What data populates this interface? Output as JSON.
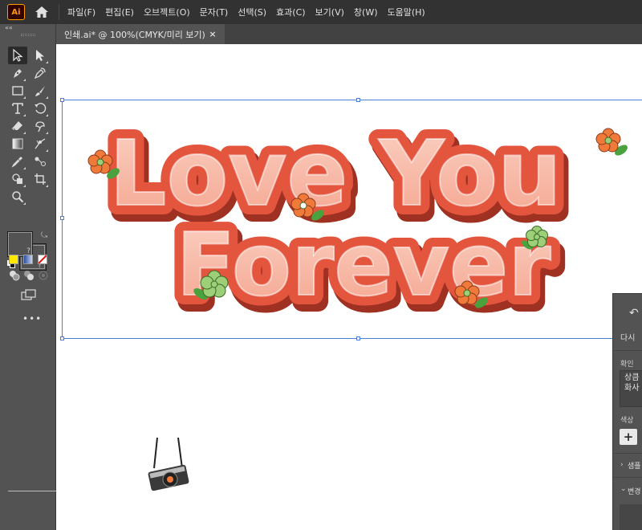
{
  "app": {
    "logo_text": "Ai",
    "accent": "#ff9a00"
  },
  "menu": {
    "items": [
      "파일(F)",
      "편집(E)",
      "오브젝트(O)",
      "문자(T)",
      "선택(S)",
      "효과(C)",
      "보기(V)",
      "창(W)",
      "도움말(H)"
    ]
  },
  "document_tab": {
    "title": "인쇄.ai* @ 100%(CMYK/미리 보기)",
    "close_label": "×"
  },
  "toolbar": {
    "collapse_label": "««",
    "tools": [
      "selection-tool",
      "direct-selection-tool",
      "pen-tool",
      "curvature-tool",
      "rectangle-tool",
      "paintbrush-tool",
      "type-tool",
      "rotate-tool",
      "eraser-tool",
      "warp-tool",
      "gradient-tool",
      "mesh-tool",
      "eyedropper-tool",
      "blend-tool",
      "shape-builder-tool",
      "artboard-tool",
      "zoom-tool"
    ],
    "fill_unknown": "?",
    "stroke_unknown": "?",
    "more_label": "•••",
    "swatches": {
      "color": "#ffe800",
      "gradient": "#3a5fb0",
      "none": "#ffffff"
    }
  },
  "artwork": {
    "line1": "Love You",
    "line2": "Forever",
    "fill_color": "#f7b5a2",
    "outline_color": "#e4553e",
    "shadow_color": "#b93b2b",
    "flower_orange": "#f07a3a",
    "flower_green": "#9ccf78",
    "leaf_green": "#4aa23f"
  },
  "right_panel": {
    "undo_icon": "undo-icon",
    "title_fragment": "다시 ",
    "section_confirm": "확인",
    "textarea_line1": "상큼",
    "textarea_line2": "화사",
    "section_color": "색상",
    "plus_label": "+",
    "collapsed_section": "샘플",
    "expanded_section": "변경"
  }
}
